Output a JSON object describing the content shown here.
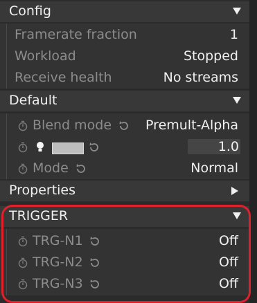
{
  "config": {
    "title": "Config",
    "rows": [
      {
        "label": "Framerate fraction",
        "value": "1"
      },
      {
        "label": "Workload",
        "value": "Stopped"
      },
      {
        "label": "Receive health",
        "value": "No streams"
      }
    ]
  },
  "default": {
    "title": "Default",
    "blend_mode_label": "Blend mode",
    "blend_mode_value": "Premult-Alpha",
    "opacity_value": "1.0",
    "mode_label": "Mode",
    "mode_value": "Normal"
  },
  "properties": {
    "title": "Properties"
  },
  "trigger": {
    "title": "TRIGGER",
    "rows": [
      {
        "label": "TRG-N1",
        "value": "Off"
      },
      {
        "label": "TRG-N2",
        "value": "Off"
      },
      {
        "label": "TRG-N3",
        "value": "Off"
      }
    ]
  },
  "colors": {
    "highlight": "#e0202a",
    "header_bg": "#383838",
    "row_bg": "#333333",
    "muted_text": "#8c8c8c"
  }
}
